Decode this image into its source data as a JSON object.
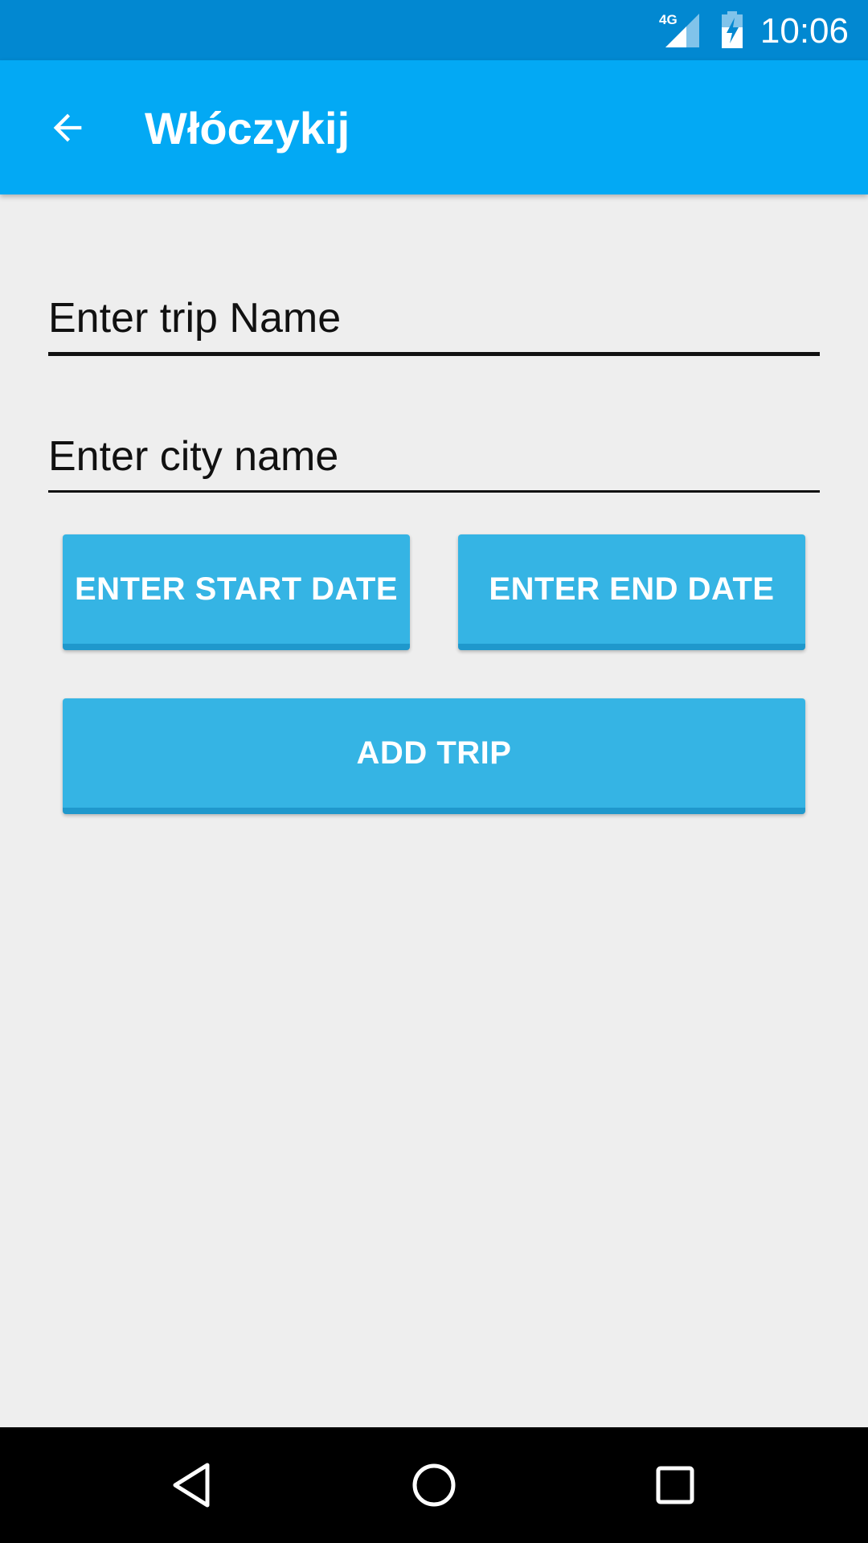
{
  "status_bar": {
    "network": "4G",
    "time": "10:06",
    "icons": [
      "signal-icon",
      "battery-charging-icon"
    ]
  },
  "app_bar": {
    "title": "Włóczykij",
    "back_icon": "arrow-back-icon"
  },
  "form": {
    "trip_name": {
      "value": "Enter trip Name"
    },
    "city_name": {
      "value": "Enter city name"
    },
    "start_date_label": "ENTER START DATE",
    "end_date_label": "ENTER END DATE",
    "add_trip_label": "ADD TRIP"
  },
  "navigation": {
    "icons": [
      "nav-back-icon",
      "nav-home-icon",
      "nav-recents-icon"
    ]
  },
  "colors": {
    "status_bar": "#0288d1",
    "app_bar": "#03a9f4",
    "button": "#35b4e4",
    "background": "#eeeeee"
  }
}
